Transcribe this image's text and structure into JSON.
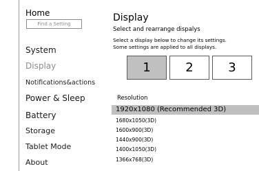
{
  "sidebar": {
    "home_label": "Home",
    "search_placeholder": "Find a Setting",
    "items": [
      {
        "label": "System"
      },
      {
        "label": "Display"
      },
      {
        "label": "Notifications&actions"
      },
      {
        "label": "Power & Sleep"
      },
      {
        "label": "Battery"
      },
      {
        "label": "Storage"
      },
      {
        "label": "Tablet Mode"
      },
      {
        "label": "About"
      }
    ]
  },
  "main": {
    "title": "Display",
    "subtitle": "Select and rearrange dispalys",
    "description_lines": [
      "Select a display below to change its settings.",
      "Some settings are applied to all displays."
    ],
    "monitors": [
      {
        "label": "1",
        "selected": true
      },
      {
        "label": "2",
        "selected": false
      },
      {
        "label": "3",
        "selected": false
      }
    ],
    "resolution": {
      "label": "Resolution",
      "options": [
        {
          "label": "1920x1080 (Recommended 3D)",
          "selected": true
        },
        {
          "label": "1680x1050(3D)"
        },
        {
          "label": "1600x900(3D)"
        },
        {
          "label": "1440x900(3D)"
        },
        {
          "label": "1400x1050(3D)"
        },
        {
          "label": "1366x768(3D)"
        }
      ]
    }
  },
  "colors": {
    "selected_background": "#bfbfbf",
    "inactive_text": "#8c8c8c"
  }
}
